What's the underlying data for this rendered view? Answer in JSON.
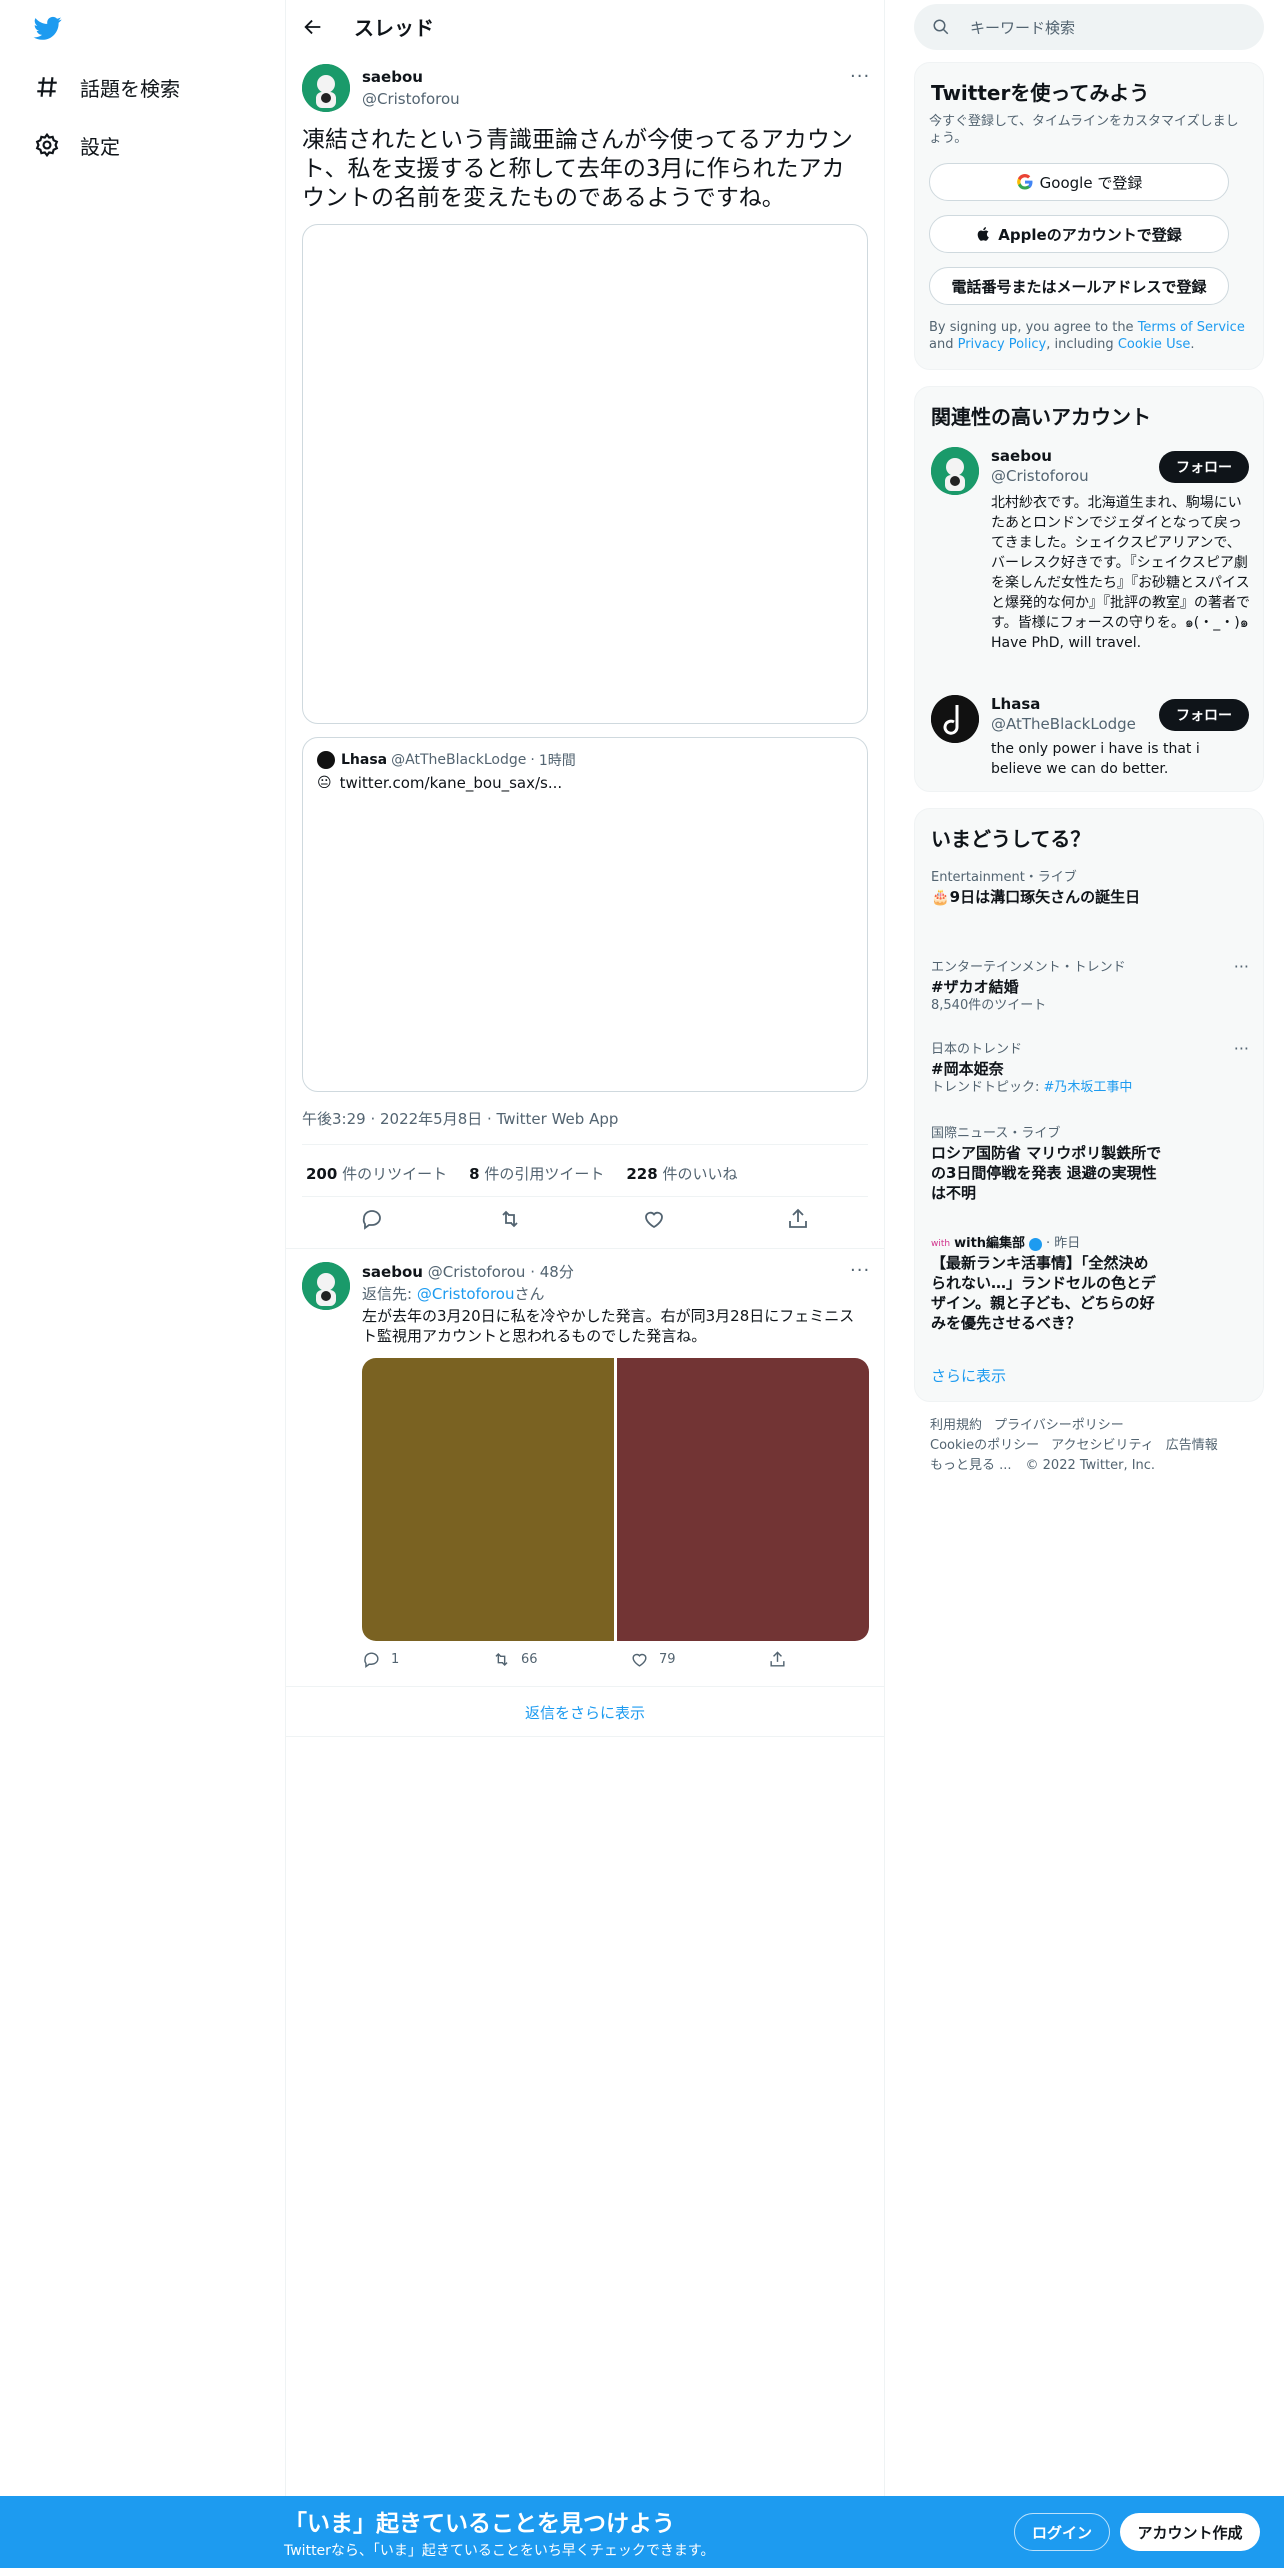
{
  "nav": {
    "logo": "twitter-bird",
    "explore_label": "話題を検索",
    "settings_label": "設定"
  },
  "header": {
    "title": "スレッド"
  },
  "tweet": {
    "author_name": "saebou",
    "author_handle": "@Cristoforou",
    "text": "凍結されたという青識亜論さんが今使ってるアカウント、私を支援すると称して去年の3月に作られたアカウントの名前を変えたものであるようですね。",
    "quote": {
      "author_name": "Lhasa",
      "author_handle": "@AtTheBlackLodge",
      "time": "1時間",
      "link": "twitter.com/kane_bou_sax/s..."
    },
    "meta": "午後3:29 · 2022年5月8日 · Twitter Web App",
    "stats": {
      "retweets_num": "200",
      "retweets_label": "件のリツイート",
      "quotes_num": "8",
      "quotes_label": "件の引用ツイート",
      "likes_num": "228",
      "likes_label": "件のいいね"
    }
  },
  "reply": {
    "author_name": "saebou",
    "author_handle": "@Cristoforou",
    "time": "48分",
    "reply_to_prefix": "返信先: ",
    "reply_to_handle": "@Cristoforou",
    "reply_to_suffix": "さん",
    "text": "左が去年の3月20日に私を冷やかした発言。右が同3月28日にフェミニスト監視用アカウントと思われるものでした発言ね。",
    "image_colors": [
      "#7a6222",
      "#723434"
    ],
    "replies": "1",
    "retweets": "66",
    "likes": "79"
  },
  "show_more_replies": "返信をさらに表示",
  "sidebar": {
    "search_placeholder": "キーワード検索",
    "signup": {
      "title": "Twitterを使ってみよう",
      "subtitle": "今すぐ登録して、タイムラインをカスタマイズしましょう。",
      "google": "Google で登録",
      "apple": "Appleのアカウントで登録",
      "phone": "電話番号またはメールアドレスで登録",
      "terms_prefix": "By signing up, you agree to the ",
      "terms_link": "Terms of Service",
      "terms_and": " and ",
      "privacy_link": "Privacy Policy",
      "terms_including": ", including ",
      "cookie_link": "Cookie Use",
      "terms_end": "."
    },
    "related": {
      "title": "関連性の高いアカウント",
      "follow_label": "フォロー",
      "accounts": [
        {
          "name": "saebou",
          "handle": "@Cristoforou",
          "bio": "北村紗衣です。北海道生まれ、駒場にいたあとロンドンでジェダイとなって戻ってきました。シェイクスピアリアンで、バーレスク好きです。『シェイクスピア劇を楽しんだ女性たち』『お砂糖とスパイスと爆発的な何か』『批評の教室』の著者です。皆様にフォースの守りを。๑(・_・)๑ Have PhD, will travel."
        },
        {
          "name": "Lhasa",
          "handle": "@AtTheBlackLodge",
          "bio": "the only power i have is that i believe we can do better."
        }
      ]
    },
    "trends": {
      "title": "いまどうしてる？",
      "items": [
        {
          "category": "Entertainment・ライブ",
          "title": "🎂9日は溝口琢矢さんの誕生日"
        },
        {
          "category": "エンターテインメント・トレンド",
          "title": "#ザカオ結婚",
          "sub": "8,540件のツイート"
        },
        {
          "category": "日本のトレンド",
          "title": "#岡本姫奈",
          "sub_prefix": "トレンドトピック: ",
          "sub_link": "#乃木坂工事中"
        },
        {
          "category": "国際ニュース・ライブ",
          "title": "ロシア国防省 マリウポリ製鉄所での3日間停戦を発表 退避の実現性は不明"
        },
        {
          "source": "with編集部",
          "time": "昨日",
          "title": "【最新ランキ活事情】「全然決められない…」ランドセルの色とデザイン。親と子ども、どちらの好みを優先させるべき？"
        }
      ],
      "show_more": "さらに表示"
    },
    "footer": {
      "terms": "利用規約",
      "privacy": "プライバシーポリシー",
      "cookie": "Cookieのポリシー",
      "accessibility": "アクセシビリティ",
      "ads": "広告情報",
      "more": "もっと見る ...",
      "copyright": "© 2022 Twitter, Inc."
    }
  },
  "bottom_bar": {
    "title": "「いま」起きていることを見つけよう",
    "subtitle": "Twitterなら、「いま」起きていることをいち早くチェックできます。",
    "login": "ログイン",
    "signup": "アカウント作成"
  },
  "colors": {
    "accent": "#1d9bf0",
    "text": "#0f1419",
    "secondary": "#536471"
  }
}
